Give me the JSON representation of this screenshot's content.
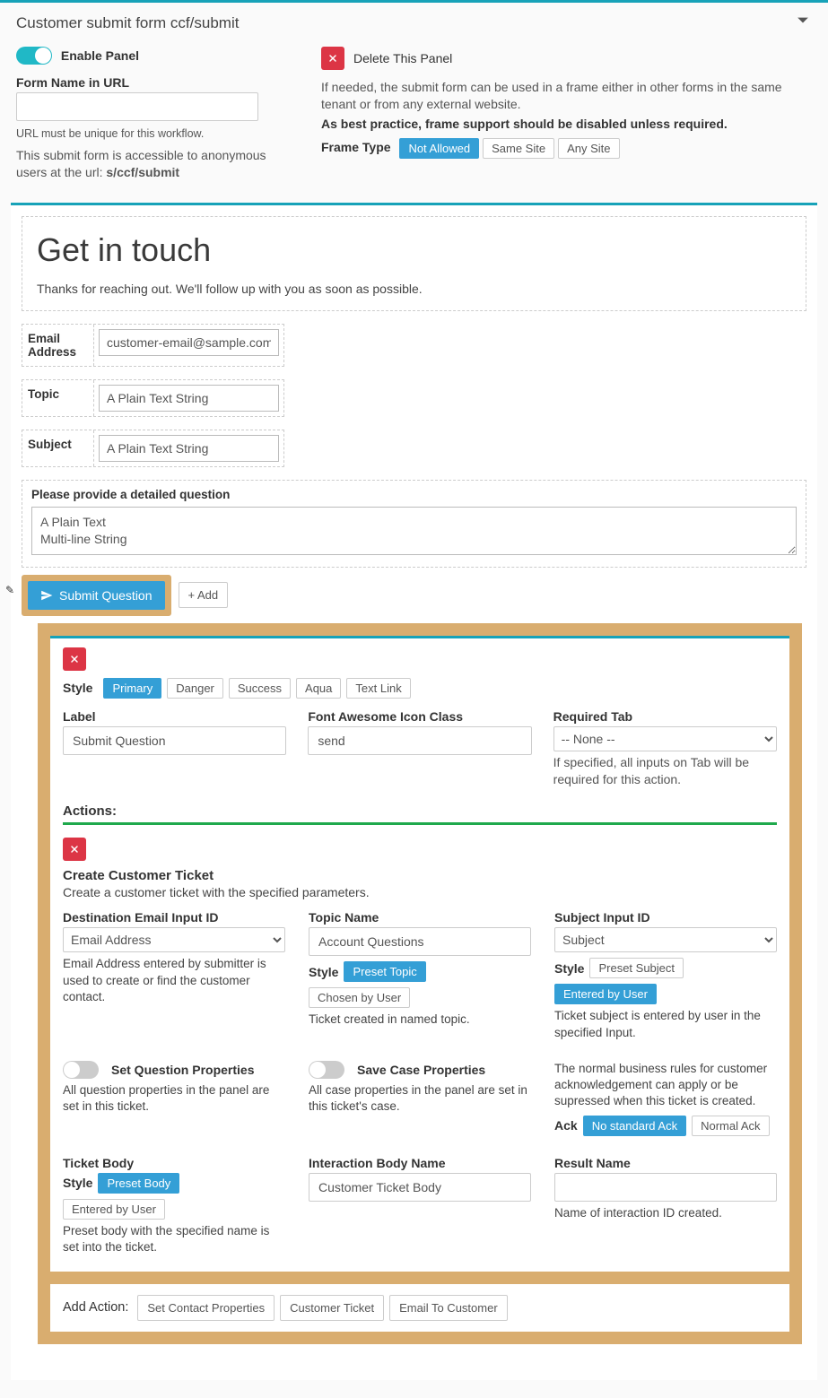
{
  "panel": {
    "title": "Customer submit form ccf/submit",
    "enable_label": "Enable Panel",
    "form_name_label": "Form Name in URL",
    "form_name_value": "",
    "url_hint": "URL must be unique for this workflow.",
    "access_hint_prefix": "This submit form is accessible to anonymous users at the url: ",
    "access_url": "s/ccf/submit",
    "delete_label": "Delete This Panel",
    "frame_help_1": "If needed, the submit form can be used in a frame either in other forms in the same tenant or from any external website.",
    "frame_help_2": "As best practice, frame support should be disabled unless required.",
    "frame_type_label": "Frame Type",
    "frame_opts": [
      "Not Allowed",
      "Same Site",
      "Any Site"
    ]
  },
  "form": {
    "heading": "Get in touch",
    "intro": "Thanks for reaching out. We'll follow up with you as soon as possible.",
    "fields": {
      "email_label": "Email Address",
      "email_value": "customer-email@sample.com",
      "topic_label": "Topic",
      "topic_value": "A Plain Text String",
      "subject_label": "Subject",
      "subject_value": "A Plain Text String",
      "detail_label": "Please provide a detailed question",
      "detail_value": "A Plain Text\nMulti-line String"
    },
    "submit_label": "Submit Question",
    "add_label": "+ Add"
  },
  "button_cfg": {
    "style_label": "Style",
    "styles": [
      "Primary",
      "Danger",
      "Success",
      "Aqua",
      "Text Link"
    ],
    "label_label": "Label",
    "label_value": "Submit Question",
    "icon_label": "Font Awesome Icon Class",
    "icon_value": "send",
    "tab_label": "Required Tab",
    "tab_value": "-- None --",
    "tab_hint": "If specified, all inputs on Tab will be required for this action."
  },
  "actions_header": "Actions:",
  "action": {
    "title": "Create Customer Ticket",
    "desc": "Create a customer ticket with the specified parameters.",
    "dest_email": {
      "label": "Destination Email Input ID",
      "value": "Email Address",
      "hint": "Email Address entered by submitter is used to create or find the customer contact."
    },
    "topic": {
      "label": "Topic Name",
      "value": "Account Questions",
      "style_label": "Style",
      "opts": [
        "Preset Topic",
        "Chosen by User"
      ],
      "hint": "Ticket created in named topic."
    },
    "subject": {
      "label": "Subject Input ID",
      "value": "Subject",
      "style_label": "Style",
      "opts": [
        "Preset Subject",
        "Entered by User"
      ],
      "hint": "Ticket subject is entered by user in the specified Input."
    },
    "set_q_label": "Set Question Properties",
    "set_q_hint": "All question properties in the panel are set in this ticket.",
    "save_case_label": "Save Case Properties",
    "save_case_hint": "All case properties in the panel are set in this ticket's case.",
    "ack_intro": "The normal business rules for customer acknowledgement can apply or be supressed when this ticket is created.",
    "ack_label": "Ack",
    "ack_opts": [
      "No standard Ack",
      "Normal Ack"
    ],
    "body": {
      "label": "Ticket Body",
      "style_label": "Style",
      "opts": [
        "Preset Body",
        "Entered by User"
      ],
      "hint": "Preset body with the specified name is set into the ticket."
    },
    "interaction": {
      "label": "Interaction Body Name",
      "value": "Customer Ticket Body"
    },
    "result": {
      "label": "Result Name",
      "value": "",
      "hint": "Name of interaction ID created."
    }
  },
  "add_action": {
    "label": "Add Action:",
    "opts": [
      "Set Contact Properties",
      "Customer Ticket",
      "Email To Customer"
    ]
  }
}
